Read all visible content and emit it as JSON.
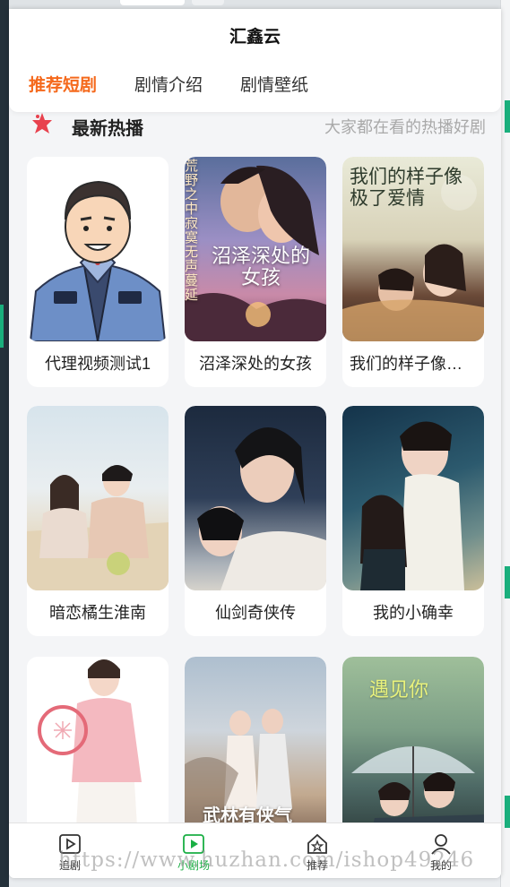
{
  "app": {
    "title": "汇鑫云"
  },
  "tabs": [
    {
      "label": "推荐短剧",
      "active": true
    },
    {
      "label": "剧情介绍",
      "active": false
    },
    {
      "label": "剧情壁纸",
      "active": false
    }
  ],
  "section": {
    "title": "最新热播",
    "subtitle": "大家都在看的热播好剧"
  },
  "dramas": [
    {
      "title": "代理视频测试1"
    },
    {
      "title": "沼泽深处的女孩",
      "poster_text": "沼泽深处的女孩",
      "poster_side": "荒野之中寂寞无声蔓延"
    },
    {
      "title": "我们的样子像极了爱情",
      "poster_text": "我们的样子像极了爱情"
    },
    {
      "title": "暗恋橘生淮南"
    },
    {
      "title": "仙剑奇侠传"
    },
    {
      "title": "我的小确幸"
    },
    {
      "title": ""
    },
    {
      "title": "",
      "poster_text": "武林有侠气"
    },
    {
      "title": "",
      "poster_text": "遇见你"
    }
  ],
  "tabbar": [
    {
      "label": "追剧",
      "icon": "play-box-icon",
      "active": false
    },
    {
      "label": "小剧场",
      "icon": "video-play-icon",
      "active": true
    },
    {
      "label": "推荐",
      "icon": "star-house-icon",
      "active": false
    },
    {
      "label": "我的",
      "icon": "user-icon",
      "active": false
    }
  ],
  "watermark": "https://www.huzhan.com/ishop49246",
  "colors": {
    "accent": "#f5691c",
    "active_green": "#1aaf44",
    "brand_green": "#1aaf7c"
  }
}
